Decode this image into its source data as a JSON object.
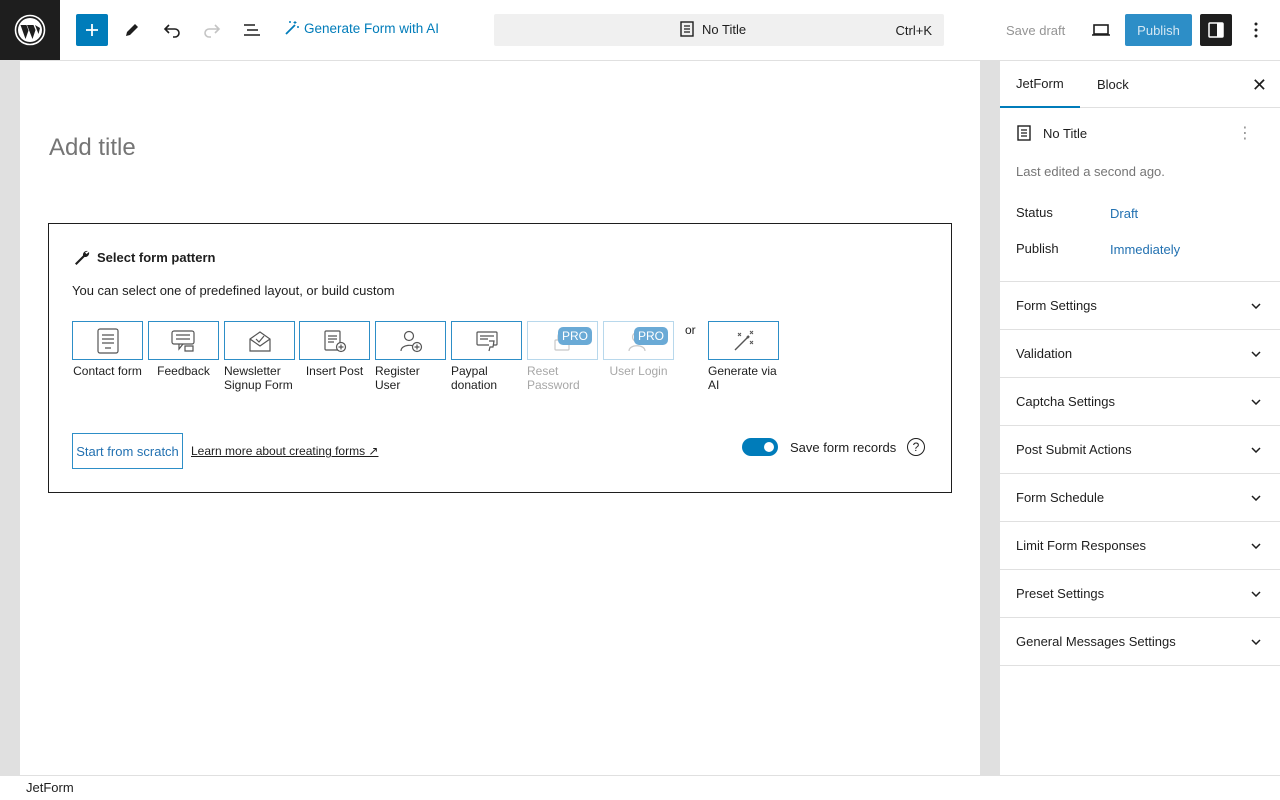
{
  "toolbar": {
    "generate_ai_label": "Generate Form with AI",
    "doc_title": "No Title",
    "shortcut": "Ctrl+K",
    "save_draft_label": "Save draft",
    "publish_label": "Publish",
    "icons": [
      "wordpress-icon",
      "plus-icon",
      "pencil-icon",
      "undo-icon",
      "redo-icon",
      "list-view-icon",
      "magic-wand-icon",
      "document-icon",
      "desktop-icon",
      "sidebar-icon",
      "kebab-icon"
    ]
  },
  "editor": {
    "title_placeholder": "Add title",
    "pattern": {
      "heading": "Select form pattern",
      "description": "You can select one of predefined layout, or build custom",
      "items": [
        {
          "label": "Contact form",
          "icon": "contact-form-icon",
          "pro": false
        },
        {
          "label": "Feedback",
          "icon": "feedback-icon",
          "pro": false
        },
        {
          "label": "Newsletter Signup Form",
          "icon": "newsletter-icon",
          "pro": false
        },
        {
          "label": "Insert Post",
          "icon": "insert-post-icon",
          "pro": false
        },
        {
          "label": "Register User",
          "icon": "register-user-icon",
          "pro": false
        },
        {
          "label": "Paypal donation",
          "icon": "paypal-icon",
          "pro": false
        },
        {
          "label": "Reset Password",
          "icon": "reset-password-icon",
          "pro": true
        },
        {
          "label": "User Login",
          "icon": "user-login-icon",
          "pro": true
        }
      ],
      "pro_badge": "PRO",
      "or_text": "or",
      "generate_ai_label": "Generate via AI",
      "scratch_label": "Start from scratch",
      "learn_more": "Learn more about creating forms ↗",
      "save_records_label": "Save form records",
      "save_records_on": true,
      "help_glyph": "?"
    }
  },
  "sidebar": {
    "tabs": [
      "JetForm",
      "Block"
    ],
    "doc_title": "No Title",
    "last_edited": "Last edited a second ago.",
    "status_label": "Status",
    "status_value": "Draft",
    "publish_label": "Publish",
    "publish_value": "Immediately",
    "panels": [
      "Form Settings",
      "Validation",
      "Captcha Settings",
      "Post Submit Actions",
      "Form Schedule",
      "Limit Form Responses",
      "Preset Settings",
      "General Messages Settings"
    ]
  },
  "footer": {
    "breadcrumb": "JetForm"
  },
  "colors": {
    "accent": "#007cba",
    "dark": "#1e1e1e"
  }
}
